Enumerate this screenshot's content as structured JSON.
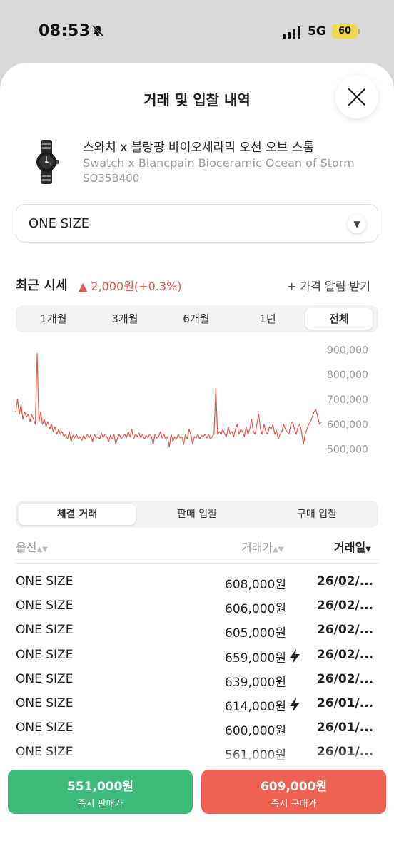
{
  "status_bar": {
    "time": "08:53",
    "network": "5G",
    "battery": "60"
  },
  "sheet": {
    "title": "거래 및 입찰 내역"
  },
  "product": {
    "name_ko": "스와치 x 블랑팡 바이오세라믹 오션 오브 스톰",
    "name_en": "Swatch x Blancpain Bioceramic Ocean of Storm",
    "code": "SO35B400"
  },
  "size_select": {
    "value": "ONE SIZE"
  },
  "price_section": {
    "title": "최근 시세",
    "change": "▲ 2,000원(+0.3%)",
    "alert_label": "+ 가격 알림 받기"
  },
  "period_tabs": [
    {
      "label": "1개월",
      "active": false
    },
    {
      "label": "3개월",
      "active": false
    },
    {
      "label": "6개월",
      "active": false
    },
    {
      "label": "1년",
      "active": false
    },
    {
      "label": "전체",
      "active": true
    }
  ],
  "colors": {
    "line": "#e5584a",
    "sell": "#3dba7a",
    "buy": "#ef6253",
    "up": "#e5584a"
  },
  "chart_data": {
    "type": "line",
    "y_ticks": [
      "900,000",
      "800,000",
      "700,000",
      "600,000",
      "500,000"
    ],
    "ylim": [
      470000,
      930000
    ],
    "grid": false,
    "series": [
      {
        "values": [
          650000,
          700000,
          640000,
          680000,
          620000,
          650000,
          630000,
          640000,
          610000,
          640000,
          620000,
          600000,
          885000,
          610000,
          650000,
          600000,
          620000,
          590000,
          610000,
          580000,
          600000,
          570000,
          590000,
          560000,
          580000,
          560000,
          570000,
          550000,
          560000,
          540000,
          570000,
          530000,
          555000,
          545000,
          560000,
          540000,
          550000,
          535000,
          555000,
          540000,
          560000,
          545000,
          555000,
          530000,
          560000,
          545000,
          550000,
          540000,
          565000,
          545000,
          560000,
          550000,
          530000,
          555000,
          540000,
          560000,
          520000,
          545000,
          560000,
          540000,
          550000,
          560000,
          545000,
          570000,
          550000,
          580000,
          540000,
          560000,
          550000,
          565000,
          545000,
          560000,
          540000,
          555000,
          545000,
          560000,
          550000,
          520000,
          560000,
          545000,
          550000,
          570000,
          545000,
          560000,
          540000,
          550000,
          510000,
          560000,
          530000,
          550000,
          540000,
          560000,
          545000,
          550000,
          520000,
          560000,
          540000,
          580000,
          560000,
          520000,
          550000,
          545000,
          560000,
          540000,
          555000,
          550000,
          560000,
          545000,
          560000,
          540000,
          550000,
          560000,
          745000,
          560000,
          570000,
          560000,
          580000,
          560000,
          550000,
          590000,
          560000,
          570000,
          550000,
          580000,
          600000,
          560000,
          580000,
          570000,
          550000,
          590000,
          560000,
          580000,
          620000,
          570000,
          560000,
          600000,
          640000,
          580000,
          560000,
          600000,
          570000,
          560000,
          590000,
          580000,
          600000,
          560000,
          575000,
          540000,
          560000,
          570000,
          600000,
          580000,
          570000,
          560000,
          600000,
          610000,
          580000,
          560000,
          590000,
          600000,
          570000,
          520000,
          560000,
          580000,
          600000,
          610000,
          630000,
          650000,
          660000,
          630000,
          600000,
          608000
        ]
      }
    ]
  },
  "trade_tabs": [
    {
      "label": "체결 거래",
      "active": true
    },
    {
      "label": "판매 입찰",
      "active": false
    },
    {
      "label": "구매 입찰",
      "active": false
    }
  ],
  "table": {
    "headers": {
      "option": "옵션",
      "price": "거래가",
      "date": "거래일"
    },
    "rows": [
      {
        "size": "ONE SIZE",
        "price": "608,000원",
        "date": "26/02/...",
        "bolt": false
      },
      {
        "size": "ONE SIZE",
        "price": "606,000원",
        "date": "26/02/...",
        "bolt": false
      },
      {
        "size": "ONE SIZE",
        "price": "605,000원",
        "date": "26/02/...",
        "bolt": false
      },
      {
        "size": "ONE SIZE",
        "price": "659,000원",
        "date": "26/02/...",
        "bolt": true
      },
      {
        "size": "ONE SIZE",
        "price": "639,000원",
        "date": "26/02/...",
        "bolt": false
      },
      {
        "size": "ONE SIZE",
        "price": "614,000원",
        "date": "26/01/...",
        "bolt": true
      },
      {
        "size": "ONE SIZE",
        "price": "600,000원",
        "date": "26/01/...",
        "bolt": false
      },
      {
        "size": "ONE SIZE",
        "price": "561,000원",
        "date": "26/01/...",
        "bolt": false
      }
    ]
  },
  "actions": {
    "sell": {
      "price": "551,000원",
      "label": "즉시 판매가"
    },
    "buy": {
      "price": "609,000원",
      "label": "즉시 구매가"
    }
  }
}
